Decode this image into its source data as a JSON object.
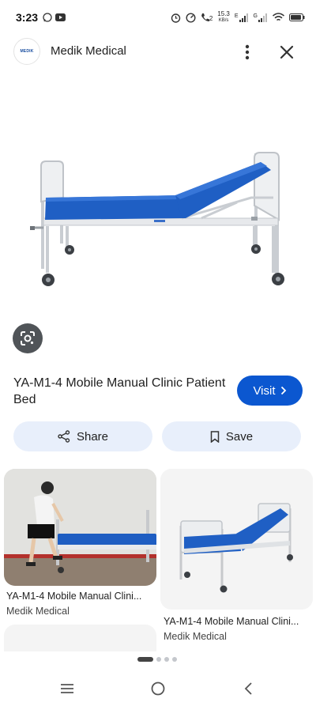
{
  "status_bar": {
    "time": "3:23",
    "net_speed_value": "15.3",
    "net_speed_unit": "KB/s",
    "network_label_e": "E",
    "network_label_g": "G",
    "sim_label": "2"
  },
  "header": {
    "site_name": "Medik Medical",
    "logo_text": "MEDIK"
  },
  "product": {
    "title": "YA-M1-4 Mobile Manual Clinic Patient Bed",
    "visit_label": "Visit",
    "share_label": "Share",
    "save_label": "Save"
  },
  "related": [
    {
      "caption": "YA-M1-4 Mobile Manual Clini...",
      "source": "Medik Medical"
    },
    {
      "caption": "YA-M1-4 Mobile Manual Clini...",
      "source": "Medik Medical"
    }
  ],
  "pager": {
    "pages": 4,
    "active_index": 0
  },
  "colors": {
    "accent": "#0b57d0",
    "pill_bg": "#e8effb",
    "mattress": "#1f5fc4"
  },
  "icons": [
    "whatsapp-icon",
    "youtube-icon",
    "alarm-icon",
    "speedometer-icon",
    "call-icon",
    "signal-icon",
    "wifi-icon",
    "battery-icon",
    "more-vert-icon",
    "close-icon",
    "lens-icon",
    "chevron-right-icon",
    "share-icon",
    "bookmark-icon",
    "menu-icon",
    "home-icon",
    "back-icon"
  ]
}
